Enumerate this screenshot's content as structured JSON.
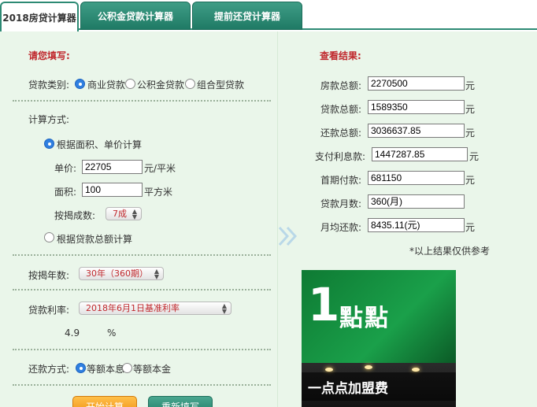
{
  "tabs": [
    {
      "label": "2018房贷计算器",
      "active": true
    },
    {
      "label": "公积金贷款计算器",
      "active": false
    },
    {
      "label": "提前还贷计算器",
      "active": false
    }
  ],
  "form": {
    "title": "请您填写:",
    "loan_type": {
      "label": "贷款类别:",
      "options": [
        "商业贷款",
        "公积金贷款",
        "组合型贷款"
      ],
      "selected": "商业贷款"
    },
    "calc_method": {
      "label": "计算方式:",
      "option_area": "根据面积、单价计算",
      "option_total": "根据贷款总额计算",
      "selected": "根据面积、单价计算",
      "unit_price_label": "单价:",
      "unit_price_value": "22705",
      "unit_price_unit": "元/平米",
      "area_label": "面积:",
      "area_value": "100",
      "area_unit": "平方米",
      "ratio_label": "按揭成数:",
      "ratio_value": "7成"
    },
    "years": {
      "label": "按揭年数:",
      "value": "30年（360期）"
    },
    "rate": {
      "label": "贷款利率:",
      "value": "2018年6月1日基准利率",
      "number": "4.9",
      "unit": "%"
    },
    "repay": {
      "label": "还款方式:",
      "options": [
        "等额本息",
        "等额本金"
      ],
      "selected": "等额本息"
    },
    "calc_button": "开始计算",
    "reset_button": "重新填写"
  },
  "results": {
    "title": "查看结果:",
    "rows": [
      {
        "label": "房款总额:",
        "value": "2270500",
        "unit": "元"
      },
      {
        "label": "贷款总额:",
        "value": "1589350",
        "unit": "元"
      },
      {
        "label": "还款总额:",
        "value": "3036637.85",
        "unit": "元"
      },
      {
        "label": "支付利息款:",
        "value": "1447287.85",
        "unit": "元"
      },
      {
        "label": "首期付款:",
        "value": "681150",
        "unit": "元"
      },
      {
        "label": "贷款月数:",
        "value": "360(月)",
        "unit": ""
      },
      {
        "label": "月均还款:",
        "value": "8435.11(元)",
        "unit": "元"
      }
    ],
    "note": "*以上结果仅供参考"
  },
  "ad": {
    "logo_char": "1",
    "logo_text": "點點",
    "caption": "一点点加盟费"
  },
  "colors": {
    "accent": "#2d8a74",
    "panel_bg": "#eaf6ea",
    "title_red": "#c0282d",
    "radio_blue": "#2f7fe0"
  }
}
